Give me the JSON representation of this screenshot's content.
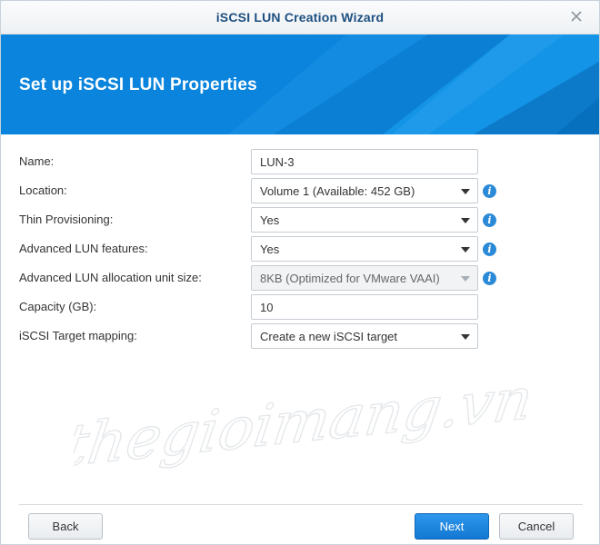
{
  "window": {
    "title": "iSCSI LUN Creation Wizard"
  },
  "banner": {
    "heading": "Set up iSCSI LUN Properties"
  },
  "form": {
    "name": {
      "label": "Name:",
      "value": "LUN-3"
    },
    "location": {
      "label": "Location:",
      "value": "Volume 1 (Available: 452 GB)",
      "icon": "info-icon"
    },
    "thin_provisioning": {
      "label": "Thin Provisioning:",
      "value": "Yes",
      "icon": "info-icon"
    },
    "advanced_features": {
      "label": "Advanced LUN features:",
      "value": "Yes",
      "icon": "info-icon"
    },
    "allocation_unit": {
      "label": "Advanced LUN allocation unit size:",
      "value": "8KB (Optimized for VMware VAAI)",
      "icon": "info-icon",
      "disabled": true
    },
    "capacity": {
      "label": "Capacity (GB):",
      "value": "10"
    },
    "target_mapping": {
      "label": "iSCSI Target mapping:",
      "value": "Create a new iSCSI target"
    }
  },
  "watermark": {
    "text": "thegioimang.vn"
  },
  "footer": {
    "back_label": "Back",
    "next_label": "Next",
    "cancel_label": "Cancel"
  },
  "colors": {
    "accent": "#0a84dc",
    "title_text": "#1d4f80",
    "info_icon": "#2a8ad8"
  }
}
